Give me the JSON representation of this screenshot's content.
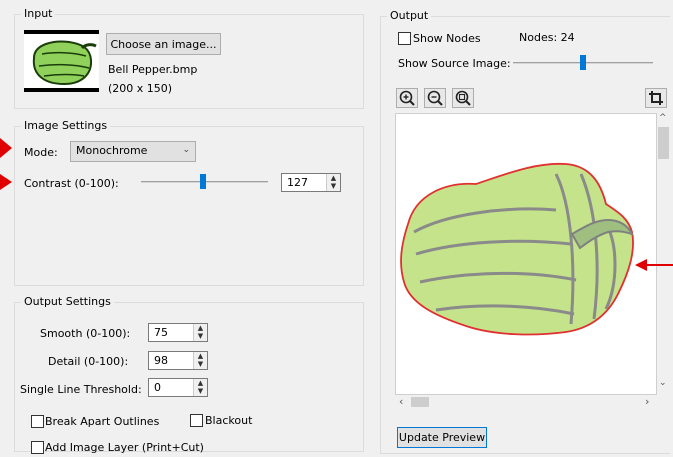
{
  "input": {
    "title": "Input",
    "choose_button": "Choose an image...",
    "file_name": "Bell Pepper.bmp",
    "dimensions": "(200 x 150)"
  },
  "image_settings": {
    "title": "Image Settings",
    "mode_label": "Mode:",
    "mode_value": "Monochrome",
    "contrast_label": "Contrast (0-100):",
    "contrast_value": "127"
  },
  "output_settings": {
    "title": "Output Settings",
    "smooth_label": "Smooth (0-100):",
    "smooth_value": "75",
    "detail_label": "Detail (0-100):",
    "detail_value": "98",
    "threshold_label": "Single Line Threshold:",
    "threshold_value": "0",
    "break_apart_label": "Break Apart Outlines",
    "blackout_label": "Blackout",
    "add_layer_label": "Add Image Layer (Print+Cut)"
  },
  "output": {
    "title": "Output",
    "show_nodes_label": "Show Nodes",
    "nodes_count": "Nodes:  24",
    "show_source_label": "Show Source Image:",
    "update_preview": "Update Preview"
  },
  "icons": [
    "zoom-in-icon",
    "zoom-out-icon",
    "zoom-fit-icon",
    "crop-icon"
  ],
  "colors": {
    "pepper_fill": "#c5e38a",
    "pepper_stroke": "#808080",
    "outline_red": "#e03030",
    "accent": "#0078d7"
  }
}
